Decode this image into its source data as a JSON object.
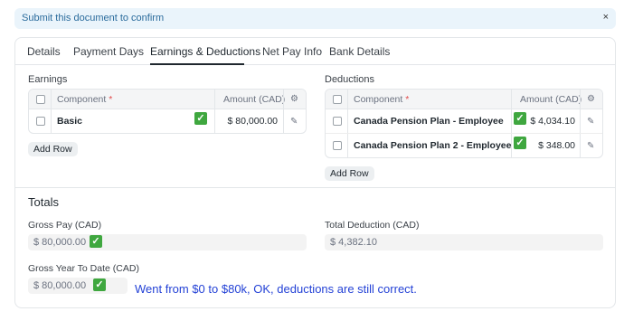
{
  "banner": {
    "text": "Submit this document to confirm",
    "close": "×"
  },
  "tabs": [
    {
      "label": "Details"
    },
    {
      "label": "Payment Days"
    },
    {
      "label": "Earnings & Deductions"
    },
    {
      "label": "Net Pay Info"
    },
    {
      "label": "Bank Details"
    }
  ],
  "active_tab": "Earnings & Deductions",
  "earnings": {
    "title": "Earnings",
    "columns": {
      "component": "Component",
      "required_mark": "*",
      "amount": "Amount (CAD)"
    },
    "rows": [
      {
        "component": "Basic",
        "amount": "$ 80,000.00",
        "checked": true
      }
    ],
    "add_row": "Add Row"
  },
  "deductions": {
    "title": "Deductions",
    "columns": {
      "component": "Component",
      "required_mark": "*",
      "amount": "Amount (CAD)"
    },
    "rows": [
      {
        "component": "Canada Pension Plan - Employee",
        "amount": "$ 4,034.10",
        "checked": true
      },
      {
        "component": "Canada Pension Plan 2 - Employee",
        "amount": "$ 348.00",
        "checked": true
      }
    ],
    "add_row": "Add Row"
  },
  "totals": {
    "title": "Totals",
    "gross_pay": {
      "label": "Gross Pay (CAD)",
      "value": "$ 80,000.00"
    },
    "total_deduction": {
      "label": "Total Deduction (CAD)",
      "value": "$ 4,382.10"
    },
    "gross_ytd": {
      "label": "Gross Year To Date (CAD)",
      "value": "$ 80,000.00"
    }
  },
  "annotation": "Went from $0 to $80k, OK, deductions are still correct.",
  "check_glyph": "✓",
  "colors": {
    "check_green": "#3fa73f",
    "annotation_blue": "#2442d6",
    "banner_bg": "#eaf4fb"
  }
}
